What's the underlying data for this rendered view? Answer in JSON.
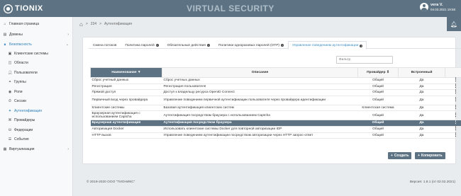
{
  "header": {
    "logo_text": "TIONIX",
    "app_title": "VIRTUAL SECURITY",
    "user_name": "vera V.",
    "user_date": "04.03.2021 19:58"
  },
  "sidebar": {
    "items": [
      {
        "label": "Главная страница",
        "icon": "home-icon"
      },
      {
        "label": "Домены",
        "icon": "domains-icon",
        "chevron": "›"
      },
      {
        "label": "Безопасность",
        "icon": "lock-icon",
        "chevron": "⌄"
      },
      {
        "label": "Клиентские системы",
        "icon": "client-icon"
      },
      {
        "label": "Области",
        "icon": "realm-icon"
      },
      {
        "label": "Пользователи",
        "icon": "user-icon"
      },
      {
        "label": "Группы",
        "icon": "group-icon"
      },
      {
        "label": "Роли",
        "icon": "role-icon"
      },
      {
        "label": "Сессии",
        "icon": "session-icon"
      },
      {
        "label": "Аутентификация",
        "icon": "auth-icon"
      },
      {
        "label": "Провайдеры",
        "icon": "provider-icon"
      },
      {
        "label": "Федерации",
        "icon": "federation-icon"
      },
      {
        "label": "События",
        "icon": "event-icon"
      },
      {
        "label": "Виртуализация",
        "icon": "virtualization-icon",
        "chevron": "›"
      }
    ]
  },
  "breadcrumb": {
    "items": [
      "234",
      "Аутентификация"
    ],
    "separator": ">"
  },
  "tabs": [
    {
      "label": "Смена потоков",
      "info": false
    },
    {
      "label": "Политика паролей",
      "info": true
    },
    {
      "label": "Обязательные действия",
      "info": true
    },
    {
      "label": "Политики одноразовых паролей (OTP)",
      "info": true
    },
    {
      "label": "Управление поведением аутентификации",
      "info": true
    }
  ],
  "filter": {
    "placeholder": "Фильтр"
  },
  "table": {
    "columns": [
      "Наименование",
      "Описание",
      "Провайдер",
      "Встроенный",
      ""
    ],
    "rows": [
      {
        "name": "Сброс учетный данных",
        "desc": "Сброс учетных данных",
        "provider": "Общий",
        "builtin": "Да"
      },
      {
        "name": "Регистрация",
        "desc": "Регистрация пользователя",
        "provider": "Общий",
        "builtin": "Да"
      },
      {
        "name": "Прямой доступ",
        "desc": "Доступ к владельцу ресурса OpenID Connect",
        "provider": "Общий",
        "builtin": "Да"
      },
      {
        "name": "Первичный вход через провайдера",
        "desc": "Управление поведением первичной аутентификации пользователя через провайдера идентификации",
        "provider": "Общий",
        "builtin": "Да"
      },
      {
        "name": "Клиентские системы",
        "desc": "Базовая аутентификация клиентских систем",
        "provider": "Клиентская система",
        "builtin": "Да"
      },
      {
        "name": "Браузерная аутентификация с использованием Captcha",
        "desc": "Аутентификация посредством браузера с использованием Captcha",
        "provider": "Общий",
        "builtin": "Да"
      },
      {
        "name": "Браузерная аутентификация",
        "desc": "Аутентификация посредством браузера",
        "provider": "Общий",
        "builtin": "Да"
      },
      {
        "name": "Авторизация Docker",
        "desc": "Использовать клиентские системы Docker для повторной авторизации IDP",
        "provider": "Общий",
        "builtin": "Да"
      },
      {
        "name": "HTTP вызов",
        "desc": "Управление поведением аутентификации посредством авторизации через HTTP запрос-ответ",
        "provider": "Общий",
        "builtin": "Да"
      }
    ],
    "more_glyph": "⋮"
  },
  "buttons": {
    "create": "Создать",
    "copy": "Копировать"
  },
  "footer": {
    "copyright": "© 2019-2020 ООО \"ТИОНИКС\"",
    "version": "Версия: 1.8.1 (от 02.02.2021)"
  },
  "colors": {
    "topbar": "#5d7383",
    "accent": "#3a8dc4",
    "selected_row": "#5d7383"
  }
}
